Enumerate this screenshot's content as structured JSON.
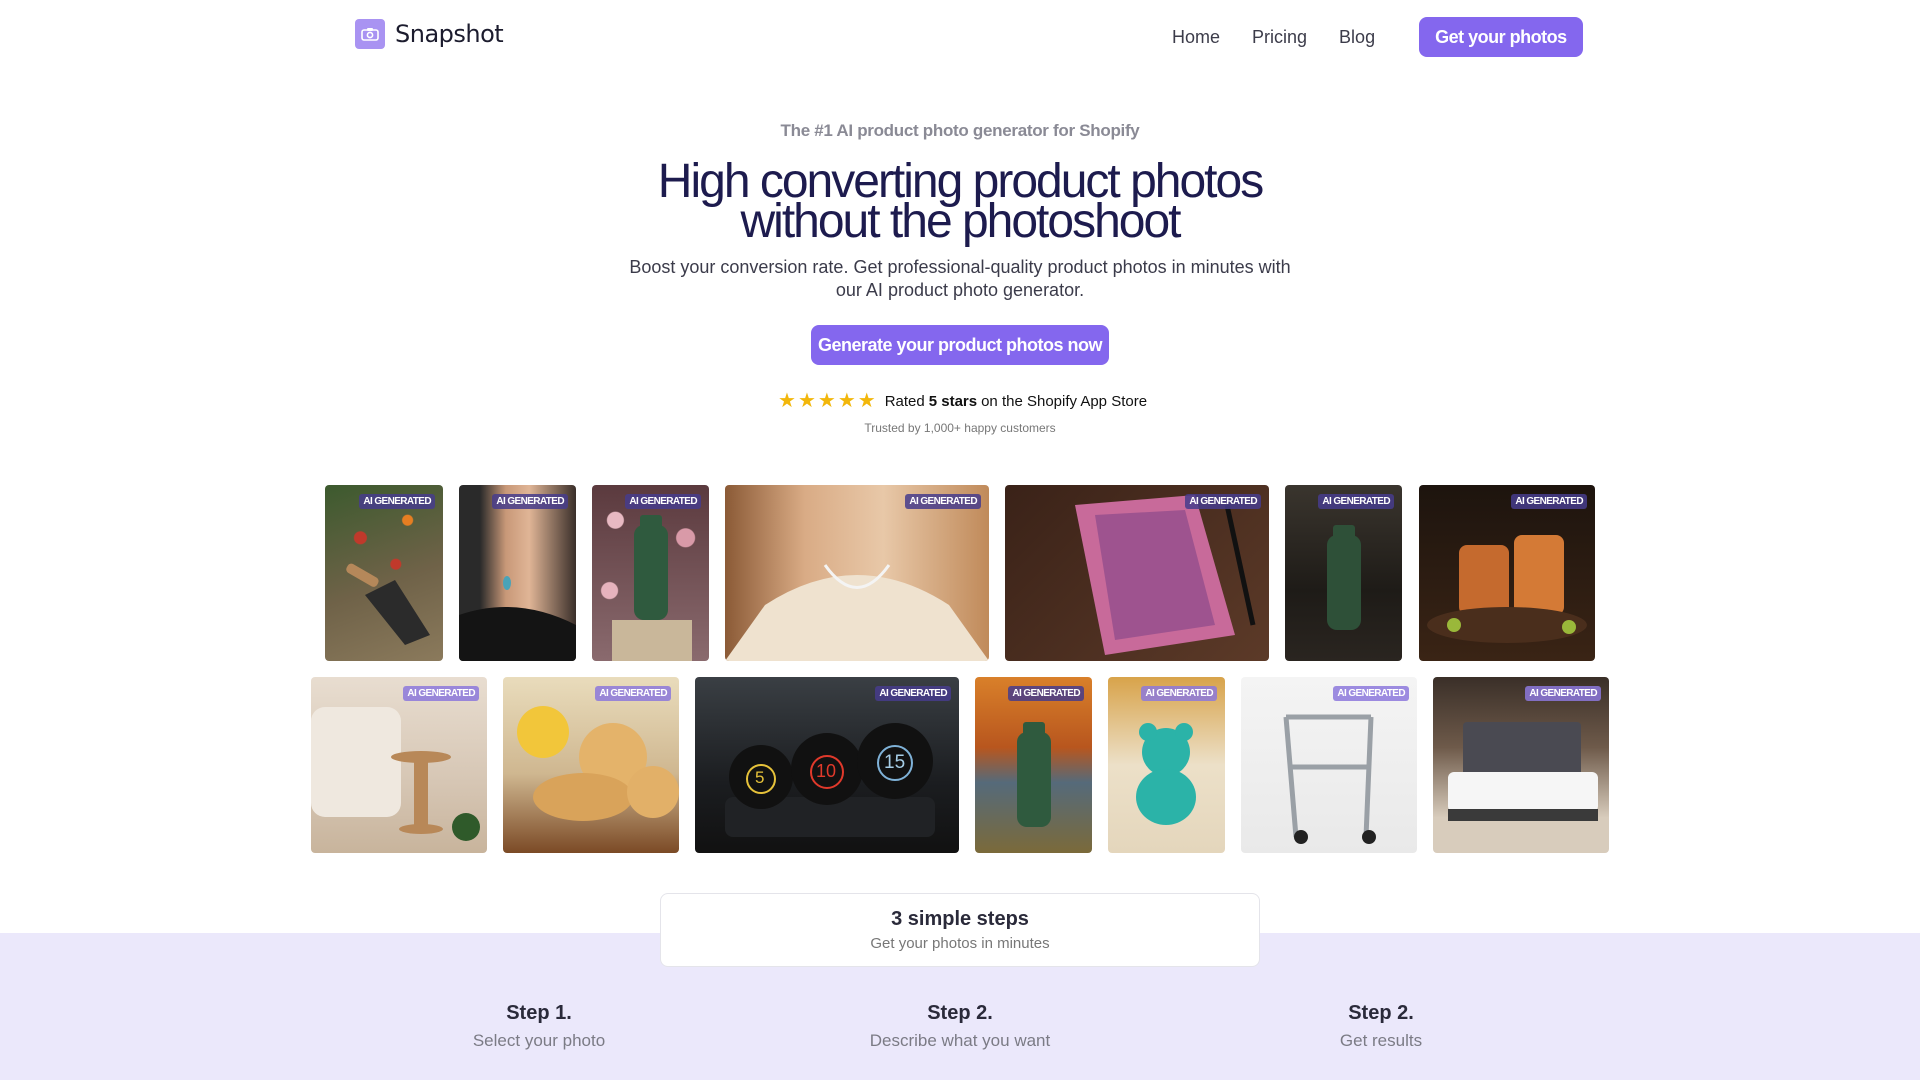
{
  "brand": {
    "name": "Snapshot",
    "icon": "camera-icon",
    "color": "#8467ee"
  },
  "nav": {
    "links": [
      "Home",
      "Pricing",
      "Blog"
    ],
    "cta": "Get your photos"
  },
  "hero": {
    "eyebrow": "The #1 AI product photo generator for Shopify",
    "headline_line1": "High converting product photos",
    "headline_line2": "without the photoshoot",
    "subhead": "Boost your conversion rate. Get professional-quality product photos in minutes with our AI product photo generator.",
    "cta": "Generate your product photos now",
    "rating": {
      "stars": 5,
      "prefix": "Rated",
      "bold": "5 stars",
      "suffix": "on the Shopify App Store",
      "star_color": "#f2b70b"
    },
    "trusted": "Trusted by 1,000+ happy customers"
  },
  "gallery": {
    "badge": "AI GENERATED",
    "row1": [
      "garden trowel",
      "earring",
      "green bottle in flowers",
      "necklace",
      "notebook and pen",
      "green bottle dark room",
      "copper mugs"
    ],
    "row2": [
      "side table with armchair",
      "lemon cookies",
      "kettlebells 5 10 15",
      "green bottle autumn lake",
      "teal teddy bear",
      "walker",
      "mattress"
    ],
    "kettlebell_labels": [
      "5",
      "10",
      "15"
    ]
  },
  "steps": {
    "title": "3 simple steps",
    "subtitle": "Get your photos in minutes",
    "items": [
      {
        "title": "Step 1.",
        "desc": "Select your photo"
      },
      {
        "title": "Step 2.",
        "desc": "Describe what you want"
      },
      {
        "title": "Step 2.",
        "desc": "Get results"
      }
    ]
  }
}
